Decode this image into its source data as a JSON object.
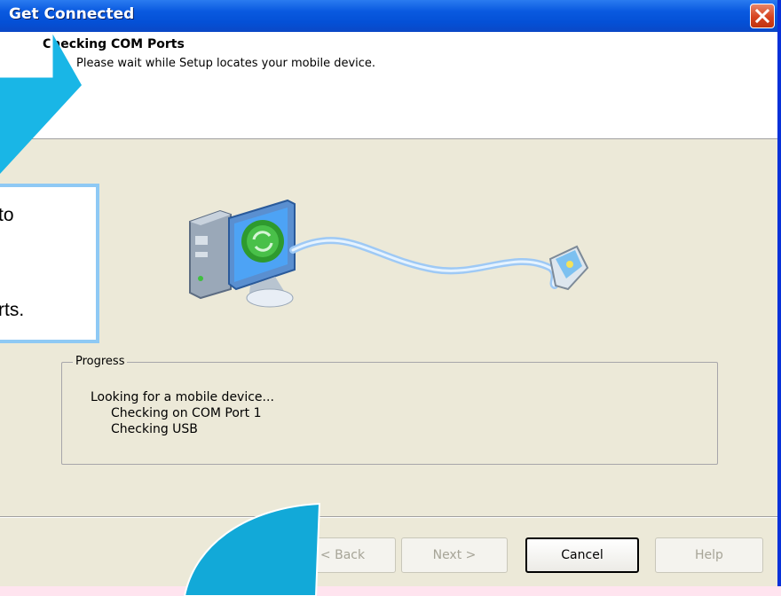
{
  "window": {
    "title": "Get Connected"
  },
  "header": {
    "title": "Checking COM Ports",
    "subtitle": "Please wait while Setup locates your mobile device."
  },
  "progress": {
    "legend": "Progress",
    "lines": [
      "Looking for a mobile device...",
      "Checking on COM Port 1",
      "Checking USB"
    ]
  },
  "buttons": {
    "back": "< Back",
    "next": "Next >",
    "cancel": "Cancel",
    "help": "Help"
  },
  "callout": {
    "lines": [
      "to",
      "rts."
    ]
  },
  "colors": {
    "titlebar": "#0a5ae0",
    "dialog_bg": "#ece9d8",
    "callout_border": "#8ec9f4",
    "arrow": "#19b6e6",
    "curve_arrow": "#12a9d8"
  },
  "icons": {
    "close": "close-icon",
    "illustration": "computer-to-device-connection-icon"
  }
}
